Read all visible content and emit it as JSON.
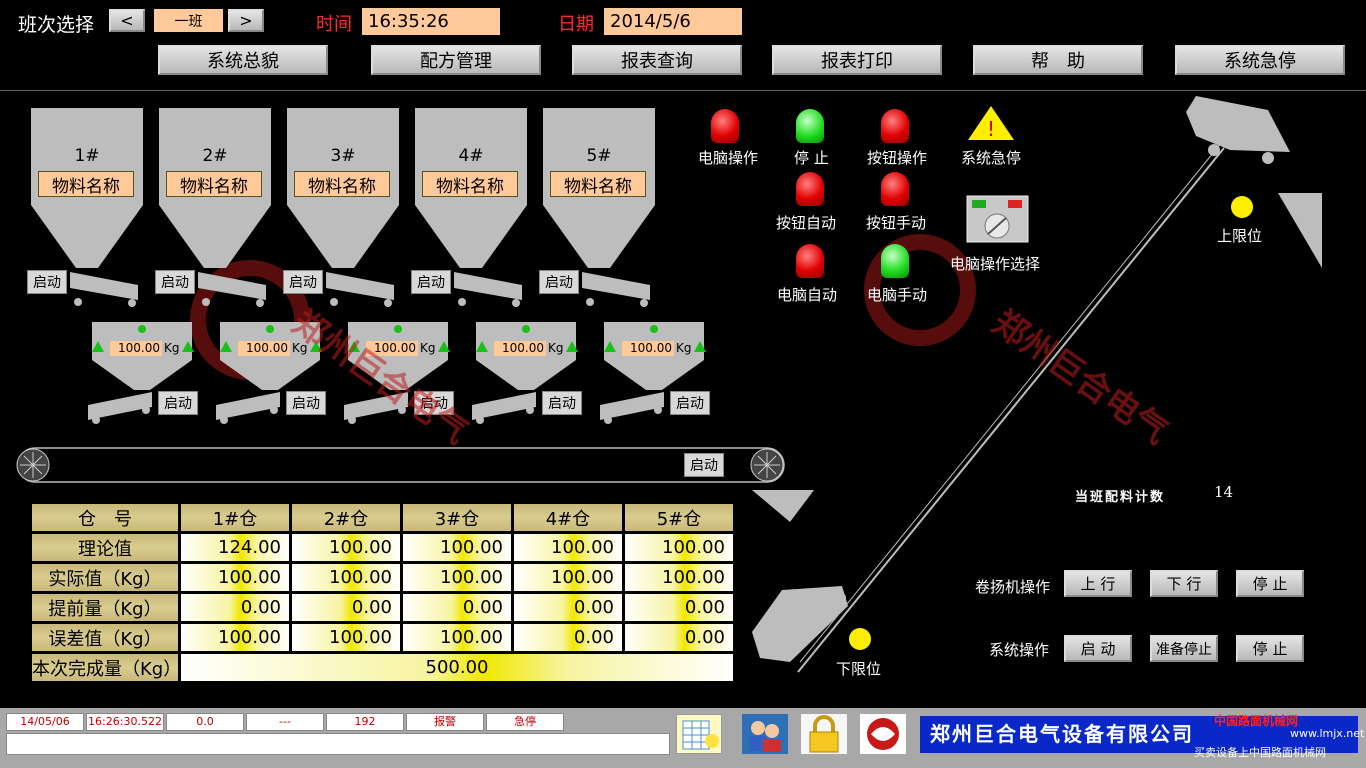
{
  "header": {
    "shift_label": "班次选择",
    "shift_value": "一班",
    "prev_icon": "chevron-left-icon",
    "next_icon": "chevron-right-icon",
    "time_label": "时间",
    "time_value": "16:35:26",
    "date_label": "日期",
    "date_value": "2014/5/6"
  },
  "menu": [
    "系统总貌",
    "配方管理",
    "报表查询",
    "报表打印",
    "帮　助",
    "系统急停"
  ],
  "hoppers": [
    {
      "num": "1#",
      "name": "物料名称",
      "start": "启动",
      "weight": "100.00",
      "unit": "Kg",
      "start2": "启动"
    },
    {
      "num": "2#",
      "name": "物料名称",
      "start": "启动",
      "weight": "100.00",
      "unit": "Kg",
      "start2": "启动"
    },
    {
      "num": "3#",
      "name": "物料名称",
      "start": "启动",
      "weight": "100.00",
      "unit": "Kg",
      "start2": "启动"
    },
    {
      "num": "4#",
      "name": "物料名称",
      "start": "启动",
      "weight": "100.00",
      "unit": "Kg",
      "start2": "启动"
    },
    {
      "num": "5#",
      "name": "物料名称",
      "start": "启动",
      "weight": "100.00",
      "unit": "Kg",
      "start2": "启动"
    }
  ],
  "belt_start": "启动",
  "indicators": {
    "pc_op": "电脑操作",
    "stop": "停 止",
    "btn_op": "按钮操作",
    "estop": "系统急停",
    "btn_auto": "按钮自动",
    "btn_manual": "按钮手动",
    "pc_auto": "电脑自动",
    "pc_manual": "电脑手动",
    "pc_select": "电脑操作选择"
  },
  "colors": {
    "lamp_red": "#e00000",
    "lamp_green": "#22dd22",
    "limit_yellow": "#ffee00",
    "field_bg": "#ffc999"
  },
  "limits": {
    "upper": "上限位",
    "lower": "下限位"
  },
  "count": {
    "label": "当班配料计数",
    "value": "14"
  },
  "winch": {
    "label": "卷扬机操作",
    "up": "上 行",
    "down": "下 行",
    "stop": "停 止"
  },
  "sysop": {
    "label": "系统操作",
    "start": "启 动",
    "prepare_stop": "准备停止",
    "stop": "停 止"
  },
  "table": {
    "headers": [
      "仓　号",
      "1#仓",
      "2#仓",
      "3#仓",
      "4#仓",
      "5#仓"
    ],
    "rows": [
      {
        "label": "理论值",
        "values": [
          "124.00",
          "100.00",
          "100.00",
          "100.00",
          "100.00"
        ]
      },
      {
        "label": "实际值（Kg）",
        "values": [
          "100.00",
          "100.00",
          "100.00",
          "100.00",
          "100.00"
        ]
      },
      {
        "label": "提前量（Kg）",
        "values": [
          "0.00",
          "0.00",
          "0.00",
          "0.00",
          "0.00"
        ]
      },
      {
        "label": "误差值（Kg）",
        "values": [
          "100.00",
          "100.00",
          "100.00",
          "0.00",
          "0.00"
        ]
      }
    ],
    "total_label": "本次完成量（Kg）",
    "total_value": "500.00"
  },
  "status": [
    "14/05/06",
    "16:26:30.522",
    "0.0",
    "---",
    "192",
    "报警",
    "急停"
  ],
  "toolbar_icons": [
    "report-bulb-icon",
    "users-icon",
    "lock-icon",
    "logo-icon"
  ],
  "company": "郑州巨合电气设备有限公司",
  "watermark": "郑州巨合电气",
  "footer_watermark": {
    "site": "中国路面机械网",
    "url": "www.lmjx.net",
    "slogan": "买卖设备上中国路面机械网"
  }
}
